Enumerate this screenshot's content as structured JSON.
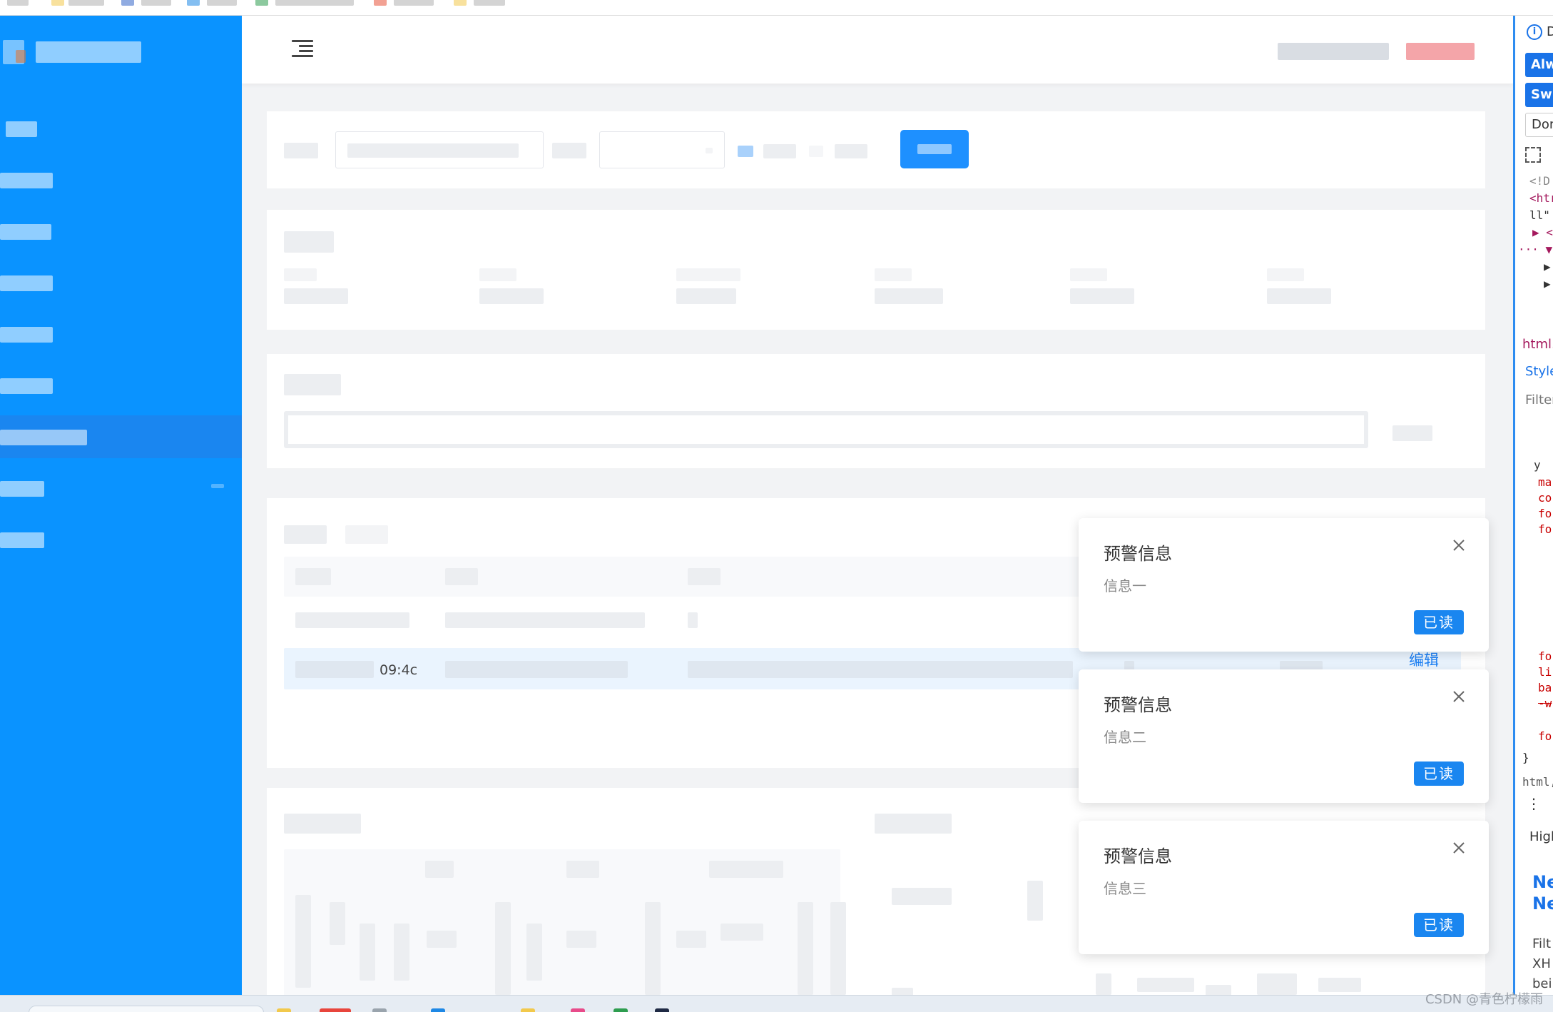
{
  "notifications": [
    {
      "title": "预警信息",
      "body": "信息一",
      "read_label": "已读"
    },
    {
      "title": "预警信息",
      "body": "信息二",
      "read_label": "已读"
    },
    {
      "title": "预警信息",
      "body": "信息三",
      "read_label": "已读"
    }
  ],
  "table": {
    "row_time_fragment": "09:4c",
    "edit_label": "编辑"
  },
  "devtools": {
    "info_label": "D",
    "always_button": "Alwa",
    "switch_button": "Swit",
    "dont_button": "Don",
    "code_lines": [
      "<!D",
      "<htr",
      "ll\"",
      "▶ <l",
      "··· ▼ <l",
      "▶",
      "▶"
    ],
    "breadcrumb": "html.",
    "styles_tab": "Style",
    "filter_placeholder": "Filter",
    "style_lines": [
      "y",
      "ma",
      "co",
      "fo",
      "fo",
      "fo",
      "li",
      "ba",
      "-w",
      "fo",
      "}"
    ],
    "html_label": "html,",
    "highlight_label": "High",
    "new_heading_1": "Ne",
    "new_heading_2": "Ne",
    "bottom_lines": [
      "Filt",
      "XH",
      "bei"
    ]
  },
  "watermark": "CSDN @青色柠檬雨",
  "colors": {
    "sidebar": "#0a93ff",
    "primary": "#1a86f0",
    "link": "#1a7ff5"
  }
}
